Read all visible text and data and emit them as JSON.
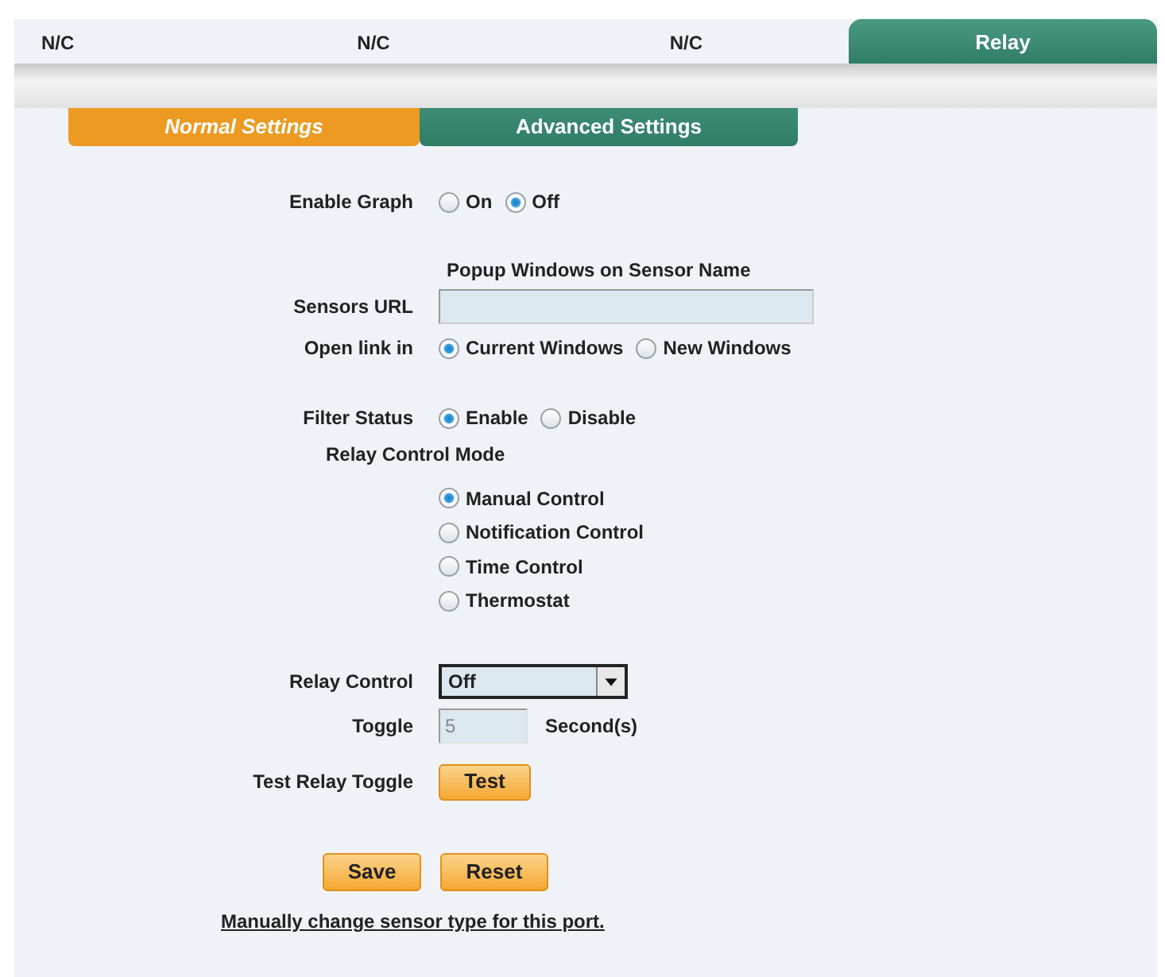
{
  "ports": [
    {
      "label": "N/C",
      "selected": false
    },
    {
      "label": "N/C",
      "selected": false
    },
    {
      "label": "N/C",
      "selected": false
    },
    {
      "label": "Relay",
      "selected": true
    }
  ],
  "tabs": [
    {
      "label": "Normal Settings",
      "selected": true
    },
    {
      "label": "Advanced Settings",
      "selected": false
    }
  ],
  "enable_graph": {
    "label": "Enable Graph",
    "options": [
      {
        "label": "On",
        "selected": false
      },
      {
        "label": "Off",
        "selected": true
      }
    ]
  },
  "popup_heading": "Popup Windows on Sensor Name",
  "sensors_url": {
    "label": "Sensors URL"
  },
  "open_link": {
    "label": "Open link in",
    "options": [
      {
        "label": "Current Windows",
        "selected": true
      },
      {
        "label": "New Windows",
        "selected": false
      }
    ]
  },
  "filter_status": {
    "label": "Filter Status",
    "options": [
      {
        "label": "Enable",
        "selected": true
      },
      {
        "label": "Disable",
        "selected": false
      }
    ]
  },
  "relay_mode": {
    "heading": "Relay Control Mode",
    "options": [
      {
        "label": "Manual Control",
        "selected": true
      },
      {
        "label": "Notification Control",
        "selected": false
      },
      {
        "label": "Time Control",
        "selected": false
      },
      {
        "label": "Thermostat",
        "selected": false
      }
    ]
  },
  "relay_control": {
    "label": "Relay Control",
    "value": "Off"
  },
  "toggle": {
    "label": "Toggle",
    "value": "5",
    "unit": "Second(s)",
    "disabled": true
  },
  "test": {
    "label": "Test Relay Toggle",
    "button": "Test"
  },
  "buttons": [
    "Save",
    "Reset"
  ],
  "link": "Manually change sensor type for this port."
}
